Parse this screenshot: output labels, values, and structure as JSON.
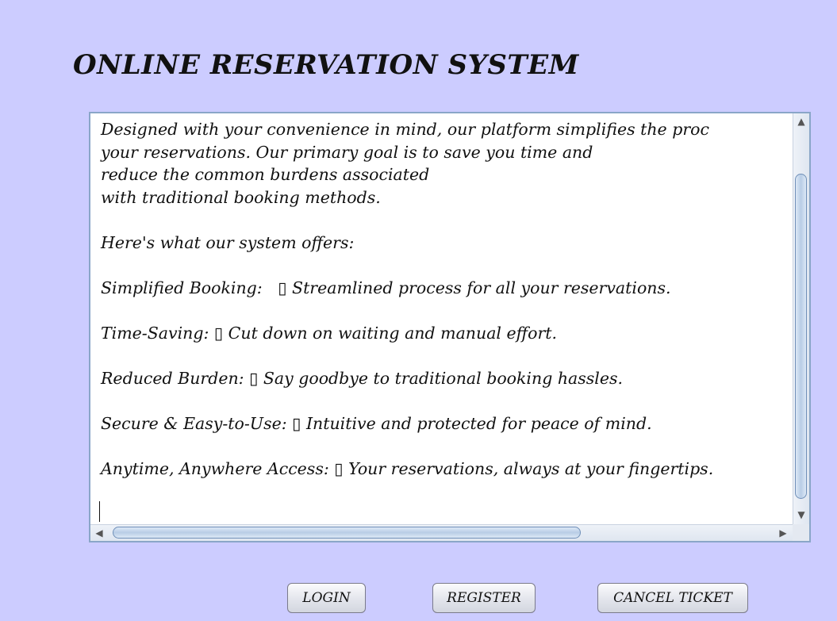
{
  "header": {
    "title": "ONLINE RESERVATION SYSTEM"
  },
  "textarea": {
    "content": "Designed with your convenience in mind, our platform simplifies the proc\nyour reservations. Our primary goal is to save you time and\nreduce the common burdens associated\nwith traditional booking methods.\n\nHere's what our system offers:\n\nSimplified Booking:   ▯ Streamlined process for all your reservations.\n\nTime-Saving: ▯ Cut down on waiting and manual effort.\n\nReduced Burden: ▯ Say goodbye to traditional booking hassles.\n\nSecure & Easy-to-Use: ▯ Intuitive and protected for peace of mind.\n\nAnytime, Anywhere Access: ▯ Your reservations, always at your fingertips."
  },
  "scrollbars": {
    "up_arrow_icon": "triangle-up",
    "down_arrow_icon": "triangle-down",
    "left_arrow_icon": "triangle-left",
    "right_arrow_icon": "triangle-right",
    "up_glyph": "▲",
    "down_glyph": "▼",
    "left_glyph": "◀",
    "right_glyph": "▶"
  },
  "buttons": {
    "login": "LOGIN",
    "register": "REGISTER",
    "cancel_ticket": "CANCEL TICKET"
  },
  "colors": {
    "background": "#ccccff",
    "border": "#8aa6c8"
  }
}
